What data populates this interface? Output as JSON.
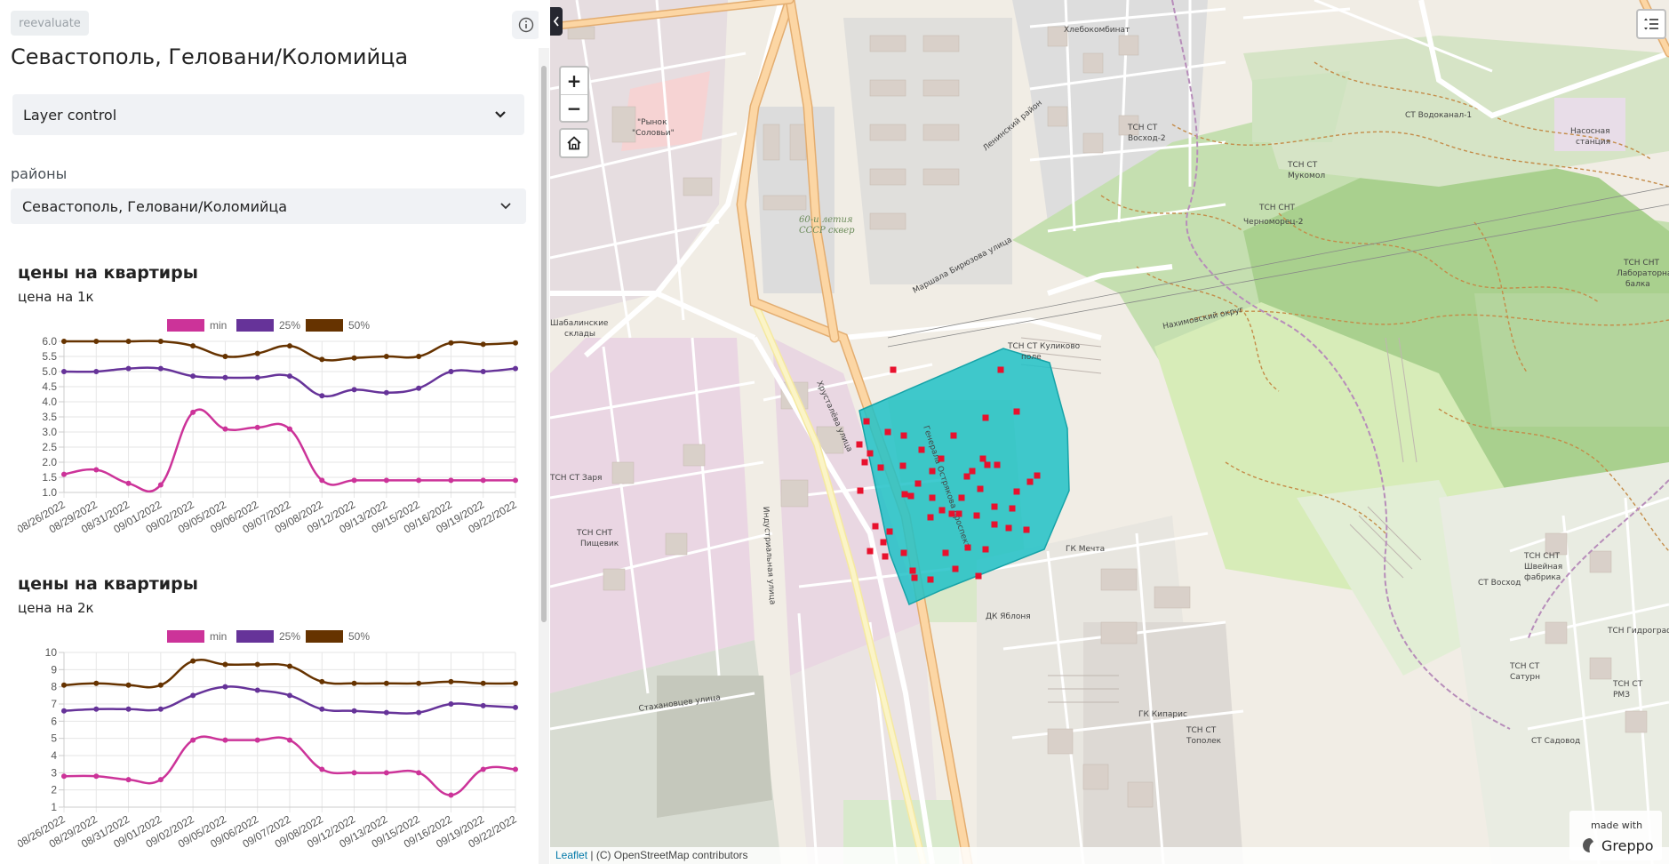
{
  "sidebar": {
    "reevaluate_label": "reevaluate",
    "title": "Севастополь, Геловани/Коломийца",
    "layer_control_label": "Layer control",
    "district_label": "районы",
    "district_selected": "Севастополь, Геловани/Коломийца"
  },
  "icons": {
    "info": "info-icon",
    "chevron": "chevron-down-icon",
    "collapse": "chevron-left-icon",
    "home": "home-icon",
    "layers": "layer-list-icon"
  },
  "colors": {
    "min": "#cc3399",
    "p25": "#663399",
    "p50": "#663300",
    "polygon": "#20c1c7",
    "points": "#e8112d"
  },
  "chart_data": [
    {
      "type": "line",
      "title": "цены на квартиры",
      "subtitle": "цена на 1к",
      "x": [
        "08/26/2022",
        "08/29/2022",
        "08/31/2022",
        "09/01/2022",
        "09/02/2022",
        "09/05/2022",
        "09/06/2022",
        "09/07/2022",
        "09/08/2022",
        "09/12/2022",
        "09/13/2022",
        "09/15/2022",
        "09/16/2022",
        "09/19/2022",
        "09/22/2022"
      ],
      "ylim": [
        1.0,
        6.0
      ],
      "yticks": [
        "1.0",
        "1.5",
        "2.0",
        "2.5",
        "3.0",
        "3.5",
        "4.0",
        "4.5",
        "5.0",
        "5.5",
        "6.0"
      ],
      "series": [
        {
          "name": "min",
          "values": [
            1.6,
            1.75,
            1.3,
            1.25,
            3.65,
            3.1,
            3.15,
            3.1,
            1.4,
            1.4,
            1.4,
            1.4,
            1.4,
            1.4,
            1.4
          ]
        },
        {
          "name": "25%",
          "values": [
            5.0,
            5.0,
            5.1,
            5.1,
            4.85,
            4.8,
            4.8,
            4.85,
            4.2,
            4.4,
            4.3,
            4.45,
            5.0,
            5.0,
            5.1
          ]
        },
        {
          "name": "50%",
          "values": [
            6.0,
            6.0,
            6.0,
            6.0,
            5.85,
            5.5,
            5.6,
            5.85,
            5.4,
            5.45,
            5.5,
            5.5,
            5.95,
            5.9,
            5.95
          ]
        }
      ],
      "legend": "top",
      "grid": true
    },
    {
      "type": "line",
      "title": "цены на квартиры",
      "subtitle": "цена на 2к",
      "x": [
        "08/26/2022",
        "08/29/2022",
        "08/31/2022",
        "09/01/2022",
        "09/02/2022",
        "09/05/2022",
        "09/06/2022",
        "09/07/2022",
        "09/08/2022",
        "09/12/2022",
        "09/13/2022",
        "09/15/2022",
        "09/16/2022",
        "09/19/2022",
        "09/22/2022"
      ],
      "ylim": [
        1,
        10
      ],
      "yticks": [
        "1",
        "2",
        "3",
        "4",
        "5",
        "6",
        "7",
        "8",
        "9",
        "10"
      ],
      "series": [
        {
          "name": "min",
          "values": [
            2.8,
            2.8,
            2.6,
            2.6,
            4.9,
            4.9,
            4.9,
            4.9,
            3.2,
            3.0,
            3.0,
            3.0,
            1.7,
            3.2,
            3.2
          ]
        },
        {
          "name": "25%",
          "values": [
            6.6,
            6.7,
            6.7,
            6.7,
            7.5,
            8.0,
            7.8,
            7.5,
            6.7,
            6.6,
            6.5,
            6.5,
            7.0,
            6.9,
            6.8
          ]
        },
        {
          "name": "50%",
          "values": [
            8.1,
            8.2,
            8.1,
            8.1,
            9.5,
            9.3,
            9.3,
            9.2,
            8.3,
            8.2,
            8.2,
            8.2,
            8.3,
            8.2,
            8.2
          ]
        }
      ],
      "legend": "top",
      "grid": true
    }
  ],
  "map": {
    "zoom_in": "+",
    "zoom_out": "−",
    "attribution_link": "Leaflet",
    "attribution_text": " | (C) OpenStreetMap contributors",
    "made_with": "made with",
    "brand": "Greppo",
    "labels": [
      "Генерала Острякова проспект",
      "Хрусталёва улица",
      "Индустриальная улица",
      "Стахановцев улица",
      "Шабалинские склады",
      "60-и летия СССР сквер",
      "Рынок \"Соловьи\"",
      "Хлебокомбинат",
      "Маршала Бирюзова улица",
      "ТСН СТ Куликово поле",
      "ГК Мечта",
      "ДК Яблоня",
      "ТСН СТ Тополек",
      "ГК Кипарис",
      "ТСН СНТ Черноморец-2",
      "ТСН СТ Восход-2",
      "ТСН СТ Мукомол",
      "СТ Водоканал-1",
      "Насосная станция",
      "ТСН СНТ Швейная фабрика",
      "СТ Восход",
      "ТСН СТ Сатурн",
      "ТСН СТ РМЗ",
      "СТ Садовод",
      "ТСН Гидрограф",
      "ТСН СНТ Пищевик",
      "ТСН СТ Заря",
      "ТСН СНТ Лабораторная балка",
      "Нахимовский округ",
      "Ленинский район"
    ]
  }
}
